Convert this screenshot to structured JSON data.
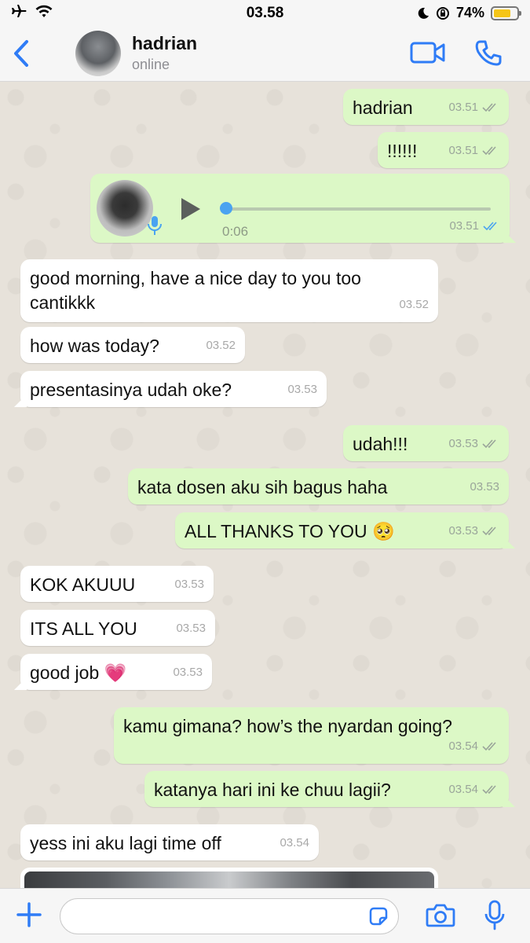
{
  "status_bar": {
    "time": "03.58",
    "battery_percent": "74%",
    "battery_level": 0.74,
    "icons": [
      "airplane-icon",
      "wifi-icon",
      "moon-icon",
      "orientation-lock-icon",
      "battery-icon"
    ]
  },
  "header": {
    "contact_name": "hadrian",
    "status": "online"
  },
  "messages": [
    {
      "id": "m1",
      "dir": "out",
      "text": "hadrian",
      "time": "03.51",
      "ticks": "read-gray"
    },
    {
      "id": "m2",
      "dir": "out",
      "text": "!!!!!!",
      "time": "03.51",
      "ticks": "read-gray"
    },
    {
      "id": "m3",
      "dir": "out",
      "type": "voice",
      "duration": "0:06",
      "time": "03.51",
      "ticks": "read-blue"
    },
    {
      "id": "m4",
      "dir": "in",
      "text": "good morning, have a nice day to you too cantikkk",
      "time": "03.52"
    },
    {
      "id": "m5",
      "dir": "in",
      "text": "how was today?",
      "time": "03.52"
    },
    {
      "id": "m6",
      "dir": "in",
      "text": "presentasinya udah oke?",
      "time": "03.53"
    },
    {
      "id": "m7",
      "dir": "out",
      "text": "udah!!!",
      "time": "03.53",
      "ticks": "read-gray"
    },
    {
      "id": "m8",
      "dir": "out",
      "text": "kata dosen aku sih bagus haha",
      "time": "03.53"
    },
    {
      "id": "m9",
      "dir": "out",
      "text": "ALL THANKS TO YOU 🥺",
      "time": "03.53",
      "ticks": "read-gray"
    },
    {
      "id": "m10",
      "dir": "in",
      "text": "KOK AKUUU",
      "time": "03.53"
    },
    {
      "id": "m11",
      "dir": "in",
      "text": "ITS ALL YOU",
      "time": "03.53"
    },
    {
      "id": "m12",
      "dir": "in",
      "text": "good job 💗",
      "time": "03.53"
    },
    {
      "id": "m13",
      "dir": "out",
      "text": "kamu gimana? how’s the nyardan going?",
      "time": "03.54",
      "ticks": "read-gray"
    },
    {
      "id": "m14",
      "dir": "out",
      "text": "katanya hari ini ke chuu lagii?",
      "time": "03.54",
      "ticks": "read-gray"
    },
    {
      "id": "m15",
      "dir": "in",
      "text": "yess ini aku lagi time off",
      "time": "03.54"
    }
  ],
  "input": {
    "placeholder": ""
  },
  "colors": {
    "accent_blue": "#2f7cf6",
    "outgoing_bubble": "#dcf8c6",
    "incoming_bubble": "#ffffff",
    "read_tick_blue": "#4aa3f0",
    "tick_gray": "#9aa59a"
  }
}
